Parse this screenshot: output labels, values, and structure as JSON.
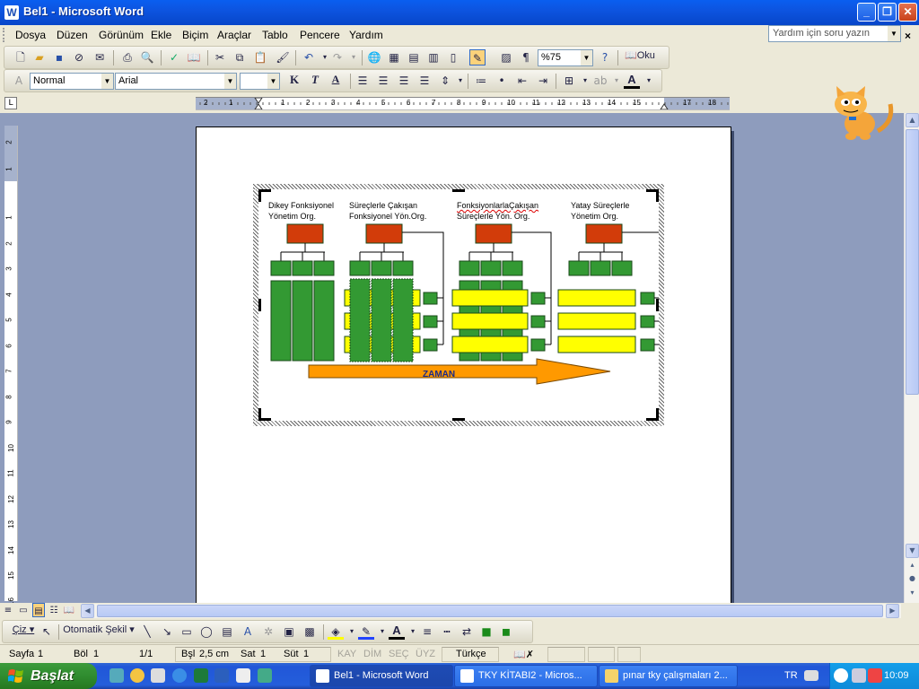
{
  "window": {
    "title": "Bel1 - Microsoft Word",
    "app_icon": "W"
  },
  "menu": {
    "items": [
      "Dosya",
      "Düzen",
      "Görünüm",
      "Ekle",
      "Biçim",
      "Araçlar",
      "Tablo",
      "Pencere",
      "Yardım"
    ],
    "help_placeholder": "Yardım için soru yazın",
    "close_doc": "×"
  },
  "standard_toolbar": {
    "zoom": "%75",
    "read_label": "Oku"
  },
  "format_toolbar": {
    "style": "Normal",
    "font": "Arial",
    "size": "",
    "bold": "K",
    "italic": "T",
    "underline": "A"
  },
  "ruler": {
    "h_labels": [
      "2",
      "1",
      "1",
      "2",
      "3",
      "4",
      "5",
      "6",
      "7",
      "8",
      "9",
      "10",
      "11",
      "12",
      "13",
      "14",
      "15",
      "17",
      "18"
    ],
    "v_labels": [
      "2",
      "1",
      "1",
      "2",
      "3",
      "4",
      "5",
      "6",
      "7",
      "8",
      "9",
      "10",
      "11",
      "12",
      "13",
      "14",
      "15",
      "16"
    ]
  },
  "diagram": {
    "columns": [
      {
        "line1": "Dikey Fonksiyonel",
        "line2": "Yönetim Org."
      },
      {
        "line1": "Süreçlerle Çakışan",
        "line2": "Fonksiyonel Yön.Org."
      },
      {
        "line1": "FonksiyonlarlaÇakışan",
        "line2": "Süreçlerle Yön. Org."
      },
      {
        "line1": "Yatay Süreçlerle",
        "line2": "Yönetim Org."
      }
    ],
    "arrow_label": "ZAMAN",
    "colors": {
      "red": "#d23c0a",
      "green": "#339933",
      "yellow": "#ffff00",
      "arrow": "#ff9900"
    }
  },
  "draw_toolbar": {
    "draw": "Çiz",
    "autoshape": "Otomatik Şekil"
  },
  "status": {
    "page": "Sayfa",
    "page_num": "1",
    "section": "Böl",
    "section_num": "1",
    "pages": "1/1",
    "pos": "Bşl",
    "pos_val": "2,5 cm",
    "line": "Sat",
    "line_val": "1",
    "col": "Süt",
    "col_val": "1",
    "rec": "KAY",
    "trk": "DİM",
    "ext": "SEÇ",
    "ovr": "ÜYZ",
    "lang": "Türkçe"
  },
  "taskbar": {
    "start": "Başlat",
    "tasks": [
      "Bel1 - Microsoft Word",
      "TKY KİTABI2 - Micros...",
      "pınar tky çalışmaları 2..."
    ],
    "lang": "TR",
    "clock": "10:09"
  }
}
